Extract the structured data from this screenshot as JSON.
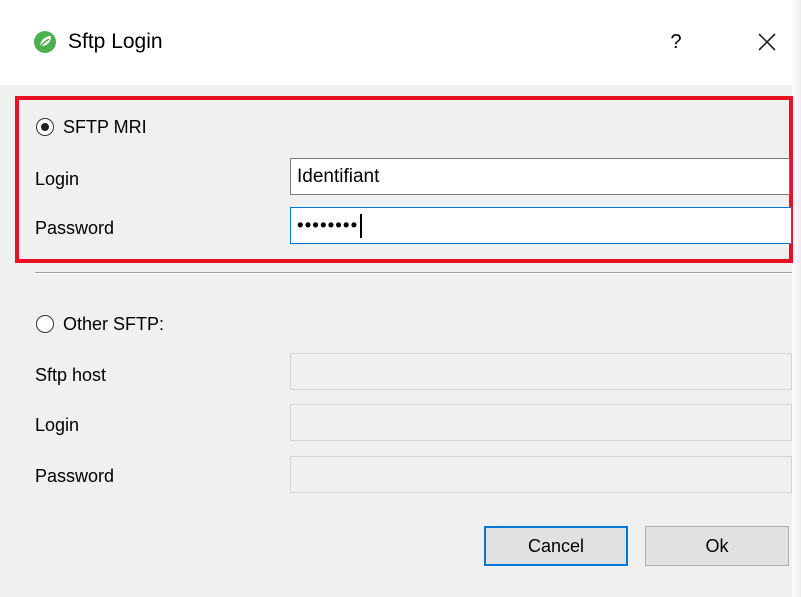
{
  "window": {
    "title": "Sftp Login",
    "help_label": "?",
    "app_icon": "app-leaf-icon",
    "close_icon": "close-icon",
    "accent_color": "#0078d7",
    "highlight_color": "#e81123"
  },
  "mri_section": {
    "radio_label": "SFTP MRI",
    "selected": true,
    "login_label": "Login",
    "login_value": "Identifiant",
    "password_label": "Password",
    "password_value": "••••••••"
  },
  "other_section": {
    "radio_label": "Other SFTP:",
    "selected": false,
    "host_label": "Sftp host",
    "host_value": "",
    "login_label": "Login",
    "login_value": "",
    "password_label": "Password",
    "password_value": ""
  },
  "buttons": {
    "cancel_label": "Cancel",
    "ok_label": "Ok"
  }
}
